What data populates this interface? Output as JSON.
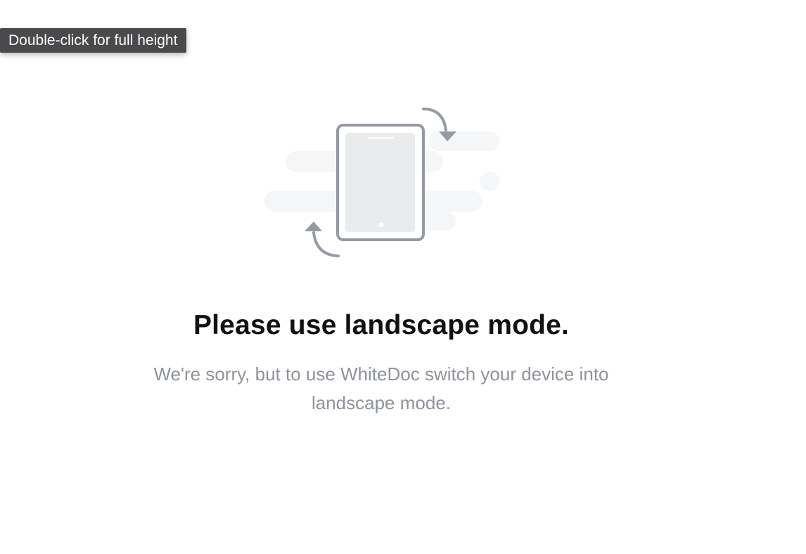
{
  "tooltip": {
    "text": "Double-click for full height"
  },
  "illustration": {
    "device_icon": "tablet-rotate-icon",
    "arrow_top_icon": "rotate-arrow-clockwise-icon",
    "arrow_bottom_icon": "rotate-arrow-counterclockwise-icon",
    "colors": {
      "stroke": "#959ba3",
      "screen": "#eaebed",
      "clouds": "#f5f6f7"
    }
  },
  "main": {
    "headline": "Please use landscape mode.",
    "message": "We're sorry, but to use WhiteDoc switch your device into landscape mode."
  }
}
